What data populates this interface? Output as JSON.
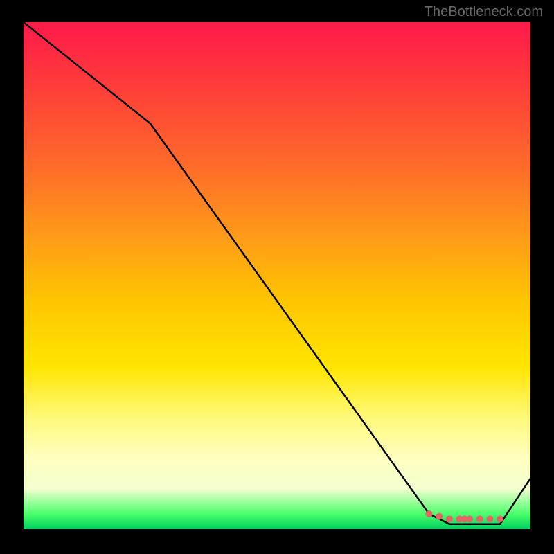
{
  "watermark": "TheBottleneck.com",
  "chart_data": {
    "type": "line",
    "title": "",
    "xlabel": "",
    "ylabel": "",
    "xlim": [
      0,
      100
    ],
    "ylim": [
      0,
      100
    ],
    "series": [
      {
        "name": "curve",
        "x": [
          0,
          25,
          80,
          84,
          90,
          94,
          100
        ],
        "values": [
          100,
          80,
          3,
          1,
          1,
          1,
          10
        ]
      }
    ],
    "markers": {
      "name": "bottom-cluster",
      "color": "#e06666",
      "x": [
        80,
        82,
        84,
        86,
        87,
        88,
        90,
        92,
        94
      ],
      "values": [
        3.0,
        2.5,
        2.0,
        2.0,
        2.0,
        2.0,
        2.0,
        2.0,
        2.0
      ]
    },
    "grid": false,
    "legend": false
  }
}
